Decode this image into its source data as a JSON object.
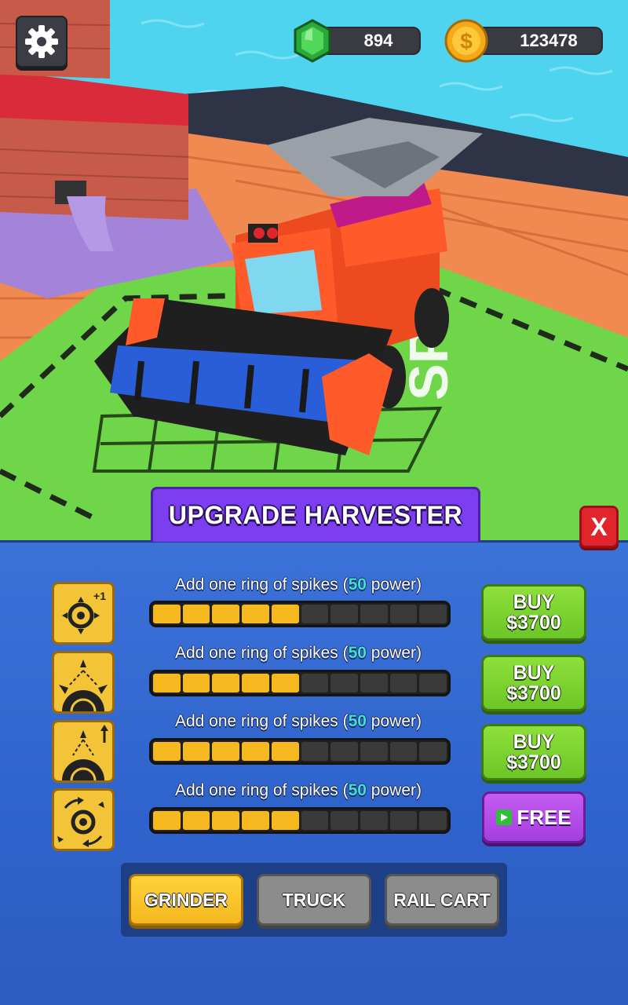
{
  "hud": {
    "gems": "894",
    "coins": "123478"
  },
  "panel": {
    "title": "UPGRADE HARVESTER",
    "close_label": "X",
    "upgrades": [
      {
        "label_pre": "Add one ring of spikes (",
        "label_num": "50",
        "label_post": " power)",
        "level": 5,
        "max": 10,
        "action_line1": "BUY",
        "action_line2": "$3700",
        "icon": "ring-plus-one-icon"
      },
      {
        "label_pre": "Add one ring of spikes (",
        "label_num": "50",
        "label_post": " power)",
        "level": 5,
        "max": 10,
        "action_line1": "BUY",
        "action_line2": "$3700",
        "icon": "spike-spread-icon"
      },
      {
        "label_pre": "Add one ring of spikes (",
        "label_num": "50",
        "label_post": " power)",
        "level": 5,
        "max": 10,
        "action_line1": "BUY",
        "action_line2": "$3700",
        "icon": "spike-height-icon"
      },
      {
        "label_pre": "Add one ring of spikes (",
        "label_num": "50",
        "label_post": " power)",
        "level": 5,
        "max": 10,
        "action_line1": "FREE",
        "action_line2": "",
        "icon": "rotation-speed-icon"
      }
    ],
    "tabs": [
      "GRINDER",
      "TRUCK",
      "RAIL CART"
    ],
    "active_tab": "GRINDER"
  },
  "colors": {
    "panel": "#3b72d8",
    "title_tab": "#7c3ff0",
    "buy": "#7ed332",
    "free": "#b04ee8",
    "progress_fill": "#f5b81f",
    "close": "#e0262c"
  }
}
